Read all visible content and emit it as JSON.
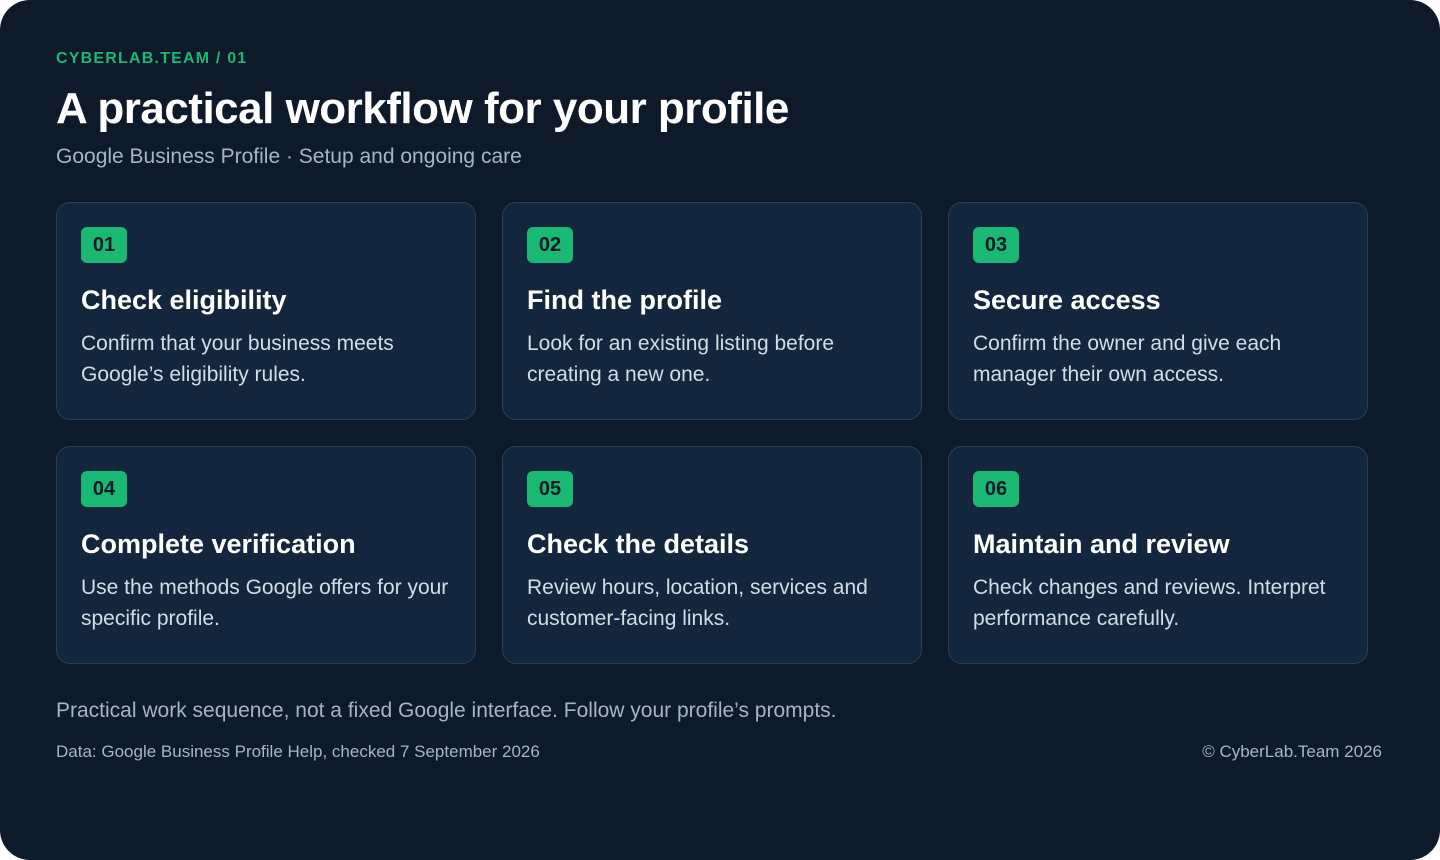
{
  "header": {
    "eyebrow": "CYBERLAB.TEAM / 01",
    "title": "A practical workflow for your profile",
    "subtitle": "Google Business Profile · Setup and ongoing care"
  },
  "steps": [
    {
      "number": "01",
      "title": "Check eligibility",
      "description": "Confirm that your business meets Google’s eligibility rules."
    },
    {
      "number": "02",
      "title": "Find the profile",
      "description": "Look for an existing listing before creating a new one."
    },
    {
      "number": "03",
      "title": "Secure access",
      "description": "Confirm the owner and give each manager their own access."
    },
    {
      "number": "04",
      "title": "Complete verification",
      "description": "Use the methods Google offers for your specific profile."
    },
    {
      "number": "05",
      "title": "Check the details",
      "description": "Review hours, location, services and customer-facing links."
    },
    {
      "number": "06",
      "title": "Maintain and review",
      "description": "Check changes and reviews. Interpret performance carefully."
    }
  ],
  "footer": {
    "note": "Practical work sequence, not a fixed Google interface. Follow your profile’s prompts.",
    "source": "Data: Google Business Profile Help, checked 7 September 2026",
    "copyright": "© CyberLab.Team  2026"
  },
  "colors": {
    "background": "#0e1a2a",
    "card": "#14263d",
    "accent": "#19b873"
  }
}
